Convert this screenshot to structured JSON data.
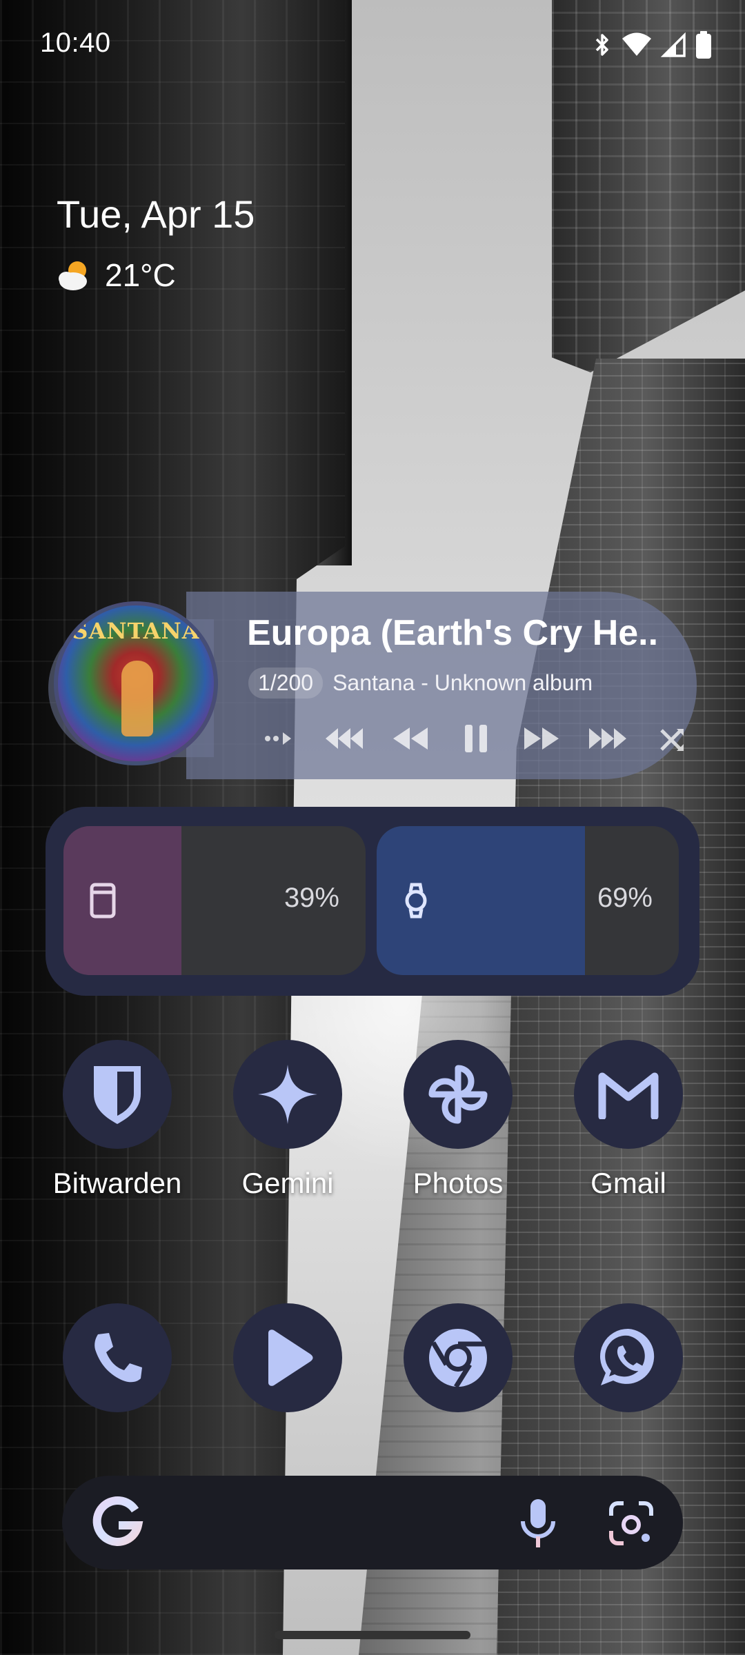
{
  "status_bar": {
    "time": "10:40"
  },
  "clock_widget": {
    "date": "Tue, Apr 15",
    "temperature": "21°C"
  },
  "media": {
    "title": "Europa (Earth's Cry He..",
    "counter": "1/200",
    "artist_album": "Santana - Unknown album",
    "album_art_text": "SANTANA"
  },
  "battery_widget": {
    "devices": [
      {
        "name": "phone",
        "percent": "39%",
        "level": 0.39,
        "color": "#5a3a5c",
        "icon": "phone-icon"
      },
      {
        "name": "watch",
        "percent": "69%",
        "level": 0.69,
        "color": "#2e4478",
        "icon": "watch-icon"
      }
    ]
  },
  "apps_row1": [
    {
      "label": "Bitwarden",
      "icon": "bitwarden-shield-icon"
    },
    {
      "label": "Gemini",
      "icon": "gemini-sparkle-icon"
    },
    {
      "label": "Photos",
      "icon": "photos-pinwheel-icon"
    },
    {
      "label": "Gmail",
      "icon": "gmail-m-icon"
    }
  ],
  "dock": [
    {
      "icon": "phone-call-icon"
    },
    {
      "icon": "play-store-icon"
    },
    {
      "icon": "chrome-icon"
    },
    {
      "icon": "whatsapp-icon"
    }
  ],
  "search_bar": {
    "logo": "G"
  },
  "colors": {
    "widget_bg": "#262a43",
    "icon_bg": "#272a42",
    "icon_fg": "#b9c6f7"
  }
}
